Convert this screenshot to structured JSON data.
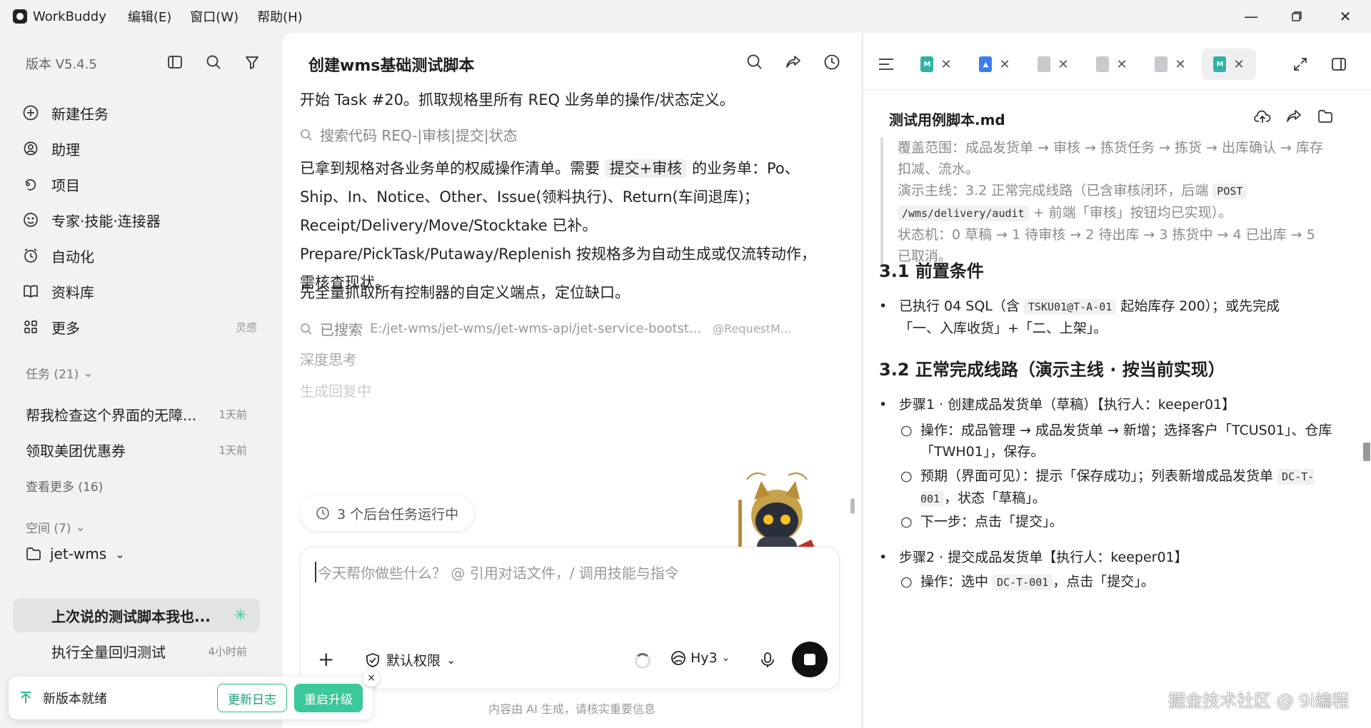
{
  "titlebar": {
    "app_name": "WorkBuddy",
    "menu": [
      "编辑(E)",
      "窗口(W)",
      "帮助(H)"
    ]
  },
  "sidebar": {
    "version": "版本 V5.4.5",
    "nav": [
      {
        "label": "新建任务",
        "icon": "plus-circle-icon"
      },
      {
        "label": "助理",
        "icon": "assistant-icon"
      },
      {
        "label": "项目",
        "icon": "project-icon"
      },
      {
        "label": "专家·技能·连接器",
        "icon": "expert-icon"
      },
      {
        "label": "自动化",
        "icon": "alarm-icon"
      },
      {
        "label": "资料库",
        "icon": "book-icon"
      },
      {
        "label": "更多",
        "icon": "grid-icon",
        "extra": "灵感"
      }
    ],
    "tasks_title": "任务 (21)",
    "tasks": [
      {
        "title": "帮我检查这个界面的无障...",
        "time": "1天前"
      },
      {
        "title": "领取美团优惠券",
        "time": "1天前"
      }
    ],
    "see_more": "查看更多 (16)",
    "space_title": "空间 (7)",
    "workspace": "jet-wms",
    "ws_tasks": [
      {
        "title": "上次说的测试脚本我也...",
        "time": "",
        "active": true
      },
      {
        "title": "执行全量回归测试",
        "time": "4小时前",
        "active": false
      }
    ]
  },
  "update": {
    "label": "新版本就绪",
    "changelog": "更新日志",
    "restart": "重启升级",
    "close": "×"
  },
  "chat": {
    "title": "创建wms基础测试脚本",
    "p1": "开始 Task #20。抓取规格里所有 REQ 业务单的操作/状态定义。",
    "search1": "搜索代码 REQ-|审核|提交|状态",
    "p2_pre": "已拿到规格对各业务单的权威操作清单。需要 ",
    "p2_chip": "提交+审核",
    "p2_post": " 的业务单：Po、Ship、In、Notice、Other、Issue(领料执行)、Return(车间退库)；Receipt/Delivery/Move/Stocktake 已补。Prepare/PickTask/Putaway/Replenish 按规格多为自动生成或仅流转动作，需核查现状。",
    "p3": "先全量抓取所有控制器的自定义端点，定位缺口。",
    "searched_label": "已搜索",
    "searched_path": "E:/jet-wms/jet-wms/jet-wms-api/jet-service-bootst...",
    "searched_extra": "@RequestM...",
    "thinking": "深度思考",
    "generating": "生成回复中",
    "bg_tasks": "3 个后台任务运行中",
    "composer_placeholder": "今天帮你做些什么？ @ 引用对话文件，/ 调用技能与指令",
    "permission": "默认权限",
    "model": "Hy3",
    "disclaimer": "内容由 AI 生成，请核实重要信息"
  },
  "doc": {
    "tabs": [
      {
        "icon": "markdown-file-icon",
        "color": "#2fb3a6",
        "glyph": "M",
        "active": false
      },
      {
        "icon": "image-file-icon",
        "color": "#3b7ef0",
        "glyph": "▲",
        "active": false
      },
      {
        "icon": "file-icon",
        "color": "#c9c9cd",
        "glyph": "",
        "active": false
      },
      {
        "icon": "file-icon",
        "color": "#c9c9cd",
        "glyph": "",
        "active": false
      },
      {
        "icon": "file-icon",
        "color": "#c9c9cd",
        "glyph": "",
        "active": false
      },
      {
        "icon": "markdown-file-icon",
        "color": "#2fb3a6",
        "glyph": "M",
        "active": true
      }
    ],
    "title": "测试用例脚本.md",
    "quote": {
      "coverage": "覆盖范围：成品发货单 → 审核 → 拣货任务 → 拣货 → 出库确认 → 库存扣减、流水。",
      "main_pre": "演示主线：3.2 正常完成线路（已含审核闭环，后端 ",
      "code1": "POST",
      "code2": "/wms/delivery/audit",
      "main_post": " + 前端「审核」按钮均已实现）。",
      "state": "状态机：0 草稿 → 1 待审核 → 2 待出库 → 3 拣货中 → 4 已出库 → 5 已取消。"
    },
    "h31": "3.1 前置条件",
    "pre_pre": "已执行 04 SQL（含 ",
    "pre_code": "TSKU01@T-A-01",
    "pre_post": " 起始库存 200）；或先完成「一、入库收货」+「二、上架」。",
    "h32": "3.2 正常完成线路（演示主线 · 按当前实现）",
    "step1": "步骤1 · 创建成品发货单（草稿）【执行人：keeper01】",
    "step1_op": "操作：成品管理 → 成品发货单 → 新增；选择客户「TCUS01」、仓库「TWH01」，保存。",
    "step1_exp_pre": "预期（界面可见）：提示「保存成功」；列表新增成品发货单 ",
    "step1_exp_code": "DC-T-001",
    "step1_exp_post": "，状态「草稿」。",
    "step1_next": "下一步：点击「提交」。",
    "step2": "步骤2 · 提交成品发货单【执行人：keeper01】",
    "step2_op_pre": "操作：选中 ",
    "step2_op_code": "DC-T-001",
    "step2_op_post": "，点击「提交」。"
  },
  "watermark": "掘金技术社区 @ 9i编程"
}
